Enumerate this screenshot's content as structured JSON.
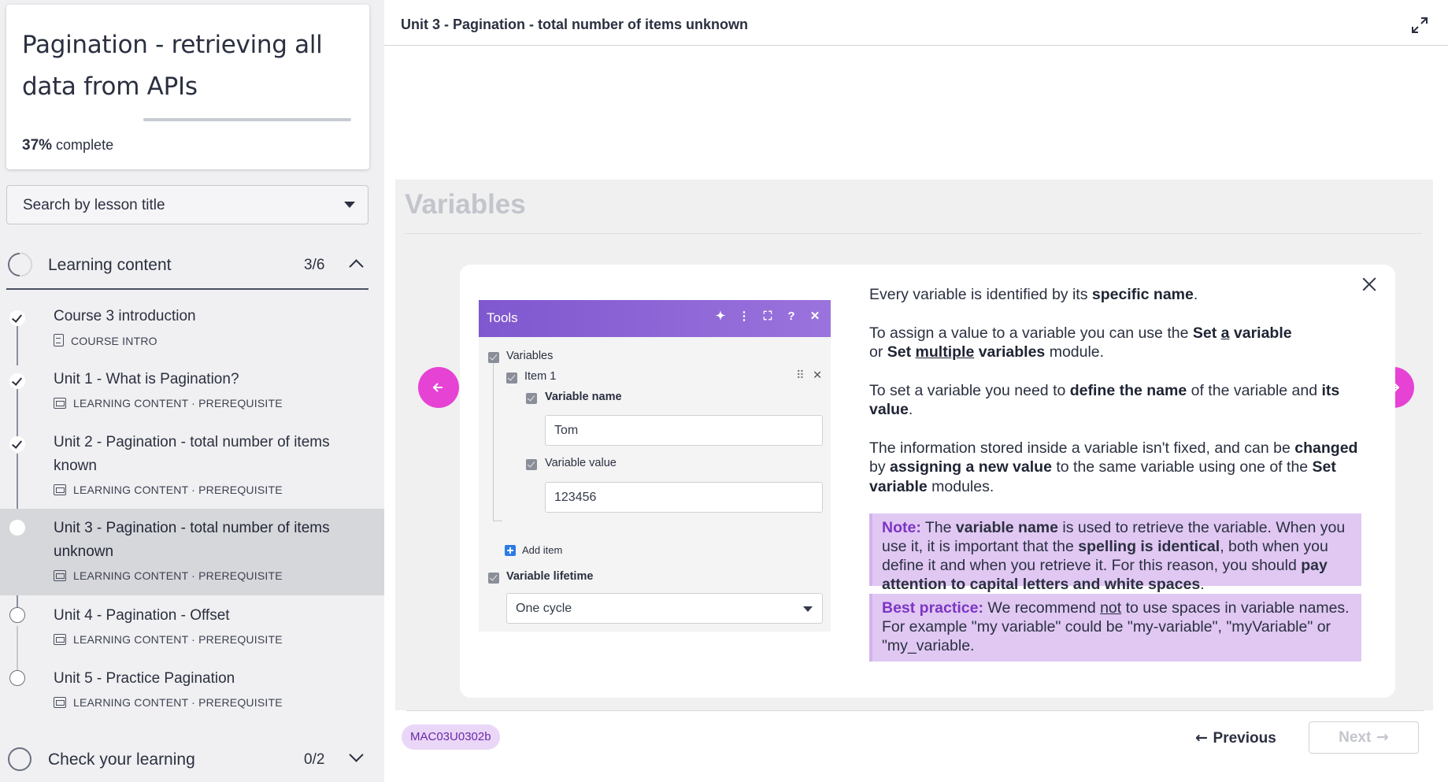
{
  "course": {
    "title": "Pagination - retrieving all data from APIs",
    "progress_percent": "37%",
    "progress_suffix": "complete",
    "progress_value": 0.37
  },
  "lesson_search": {
    "placeholder": "Search by lesson title"
  },
  "sections": [
    {
      "title": "Learning content",
      "count": "3/6",
      "expanded": true,
      "lessons": [
        {
          "title": "Course 3 introduction",
          "meta": "COURSE INTRO",
          "status": "done",
          "meta_icon": "document-icon"
        },
        {
          "title": "Unit 1 - What is Pagination?",
          "meta": "LEARNING CONTENT · PREREQUISITE",
          "status": "done",
          "meta_icon": "slides-icon"
        },
        {
          "title": "Unit 2 - Pagination - total number of items known",
          "meta": "LEARNING CONTENT · PREREQUISITE",
          "status": "done",
          "meta_icon": "slides-icon"
        },
        {
          "title": "Unit 3 - Pagination - total number of items unknown",
          "meta": "LEARNING CONTENT · PREREQUISITE",
          "status": "current",
          "meta_icon": "slides-icon"
        },
        {
          "title": "Unit 4 - Pagination - Offset",
          "meta": "LEARNING CONTENT · PREREQUISITE",
          "status": "open",
          "meta_icon": "slides-icon"
        },
        {
          "title": "Unit 5 - Practice Pagination",
          "meta": "LEARNING CONTENT · PREREQUISITE",
          "status": "open",
          "meta_icon": "slides-icon"
        }
      ]
    },
    {
      "title": "Check your learning",
      "count": "0/2",
      "expanded": false
    }
  ],
  "main": {
    "unit_title": "Unit 3 - Pagination - total number of items unknown",
    "slide_heading": "Variables",
    "tools_panel": {
      "title": "Tools",
      "variables_label": "Variables",
      "item_label": "Item 1",
      "variable_name_label": "Variable name",
      "variable_name_value": "Tom",
      "variable_value_label": "Variable value",
      "variable_value_value": "123456",
      "add_item_label": "Add item",
      "lifetime_label": "Variable lifetime",
      "lifetime_value": "One cycle"
    },
    "explanation": {
      "p1": [
        "Every variable is identified by its ",
        "specific name",
        "."
      ],
      "p2": [
        "To assign a value to a variable you can use the ",
        "Set ",
        "a",
        " variable",
        " or ",
        "Set ",
        "multiple",
        " variables",
        " module."
      ],
      "p3": [
        "To set a variable you need to ",
        "define the name",
        " of the variable and ",
        "its value",
        "."
      ],
      "p4": [
        "The information stored inside a variable isn't fixed, and can be ",
        "changed",
        " by ",
        "assigning a new value",
        " to the same variable using one of the ",
        "Set variable",
        " modules."
      ]
    },
    "note": {
      "lead": "Note:",
      "parts": [
        " The ",
        "variable name",
        " is used to retrieve the variable. When you use it, it is important that the ",
        "spelling is identical",
        ", both when you define it and when you retrieve it. For this reason, you should ",
        "pay attention to capital letters and white spaces",
        "."
      ]
    },
    "best_practice": {
      "lead": "Best practice:",
      "parts": [
        " We recommend ",
        "not",
        " to use spaces in variable names. For example \"my variable\" could be \"my-variable\", \"myVariable\" or \"my_variable."
      ]
    },
    "lesson_code": "MAC03U0302b",
    "previous_label": "Previous",
    "next_label": "Next",
    "accent_color": "#e642d4",
    "callout_color": "#e0c8f3"
  }
}
